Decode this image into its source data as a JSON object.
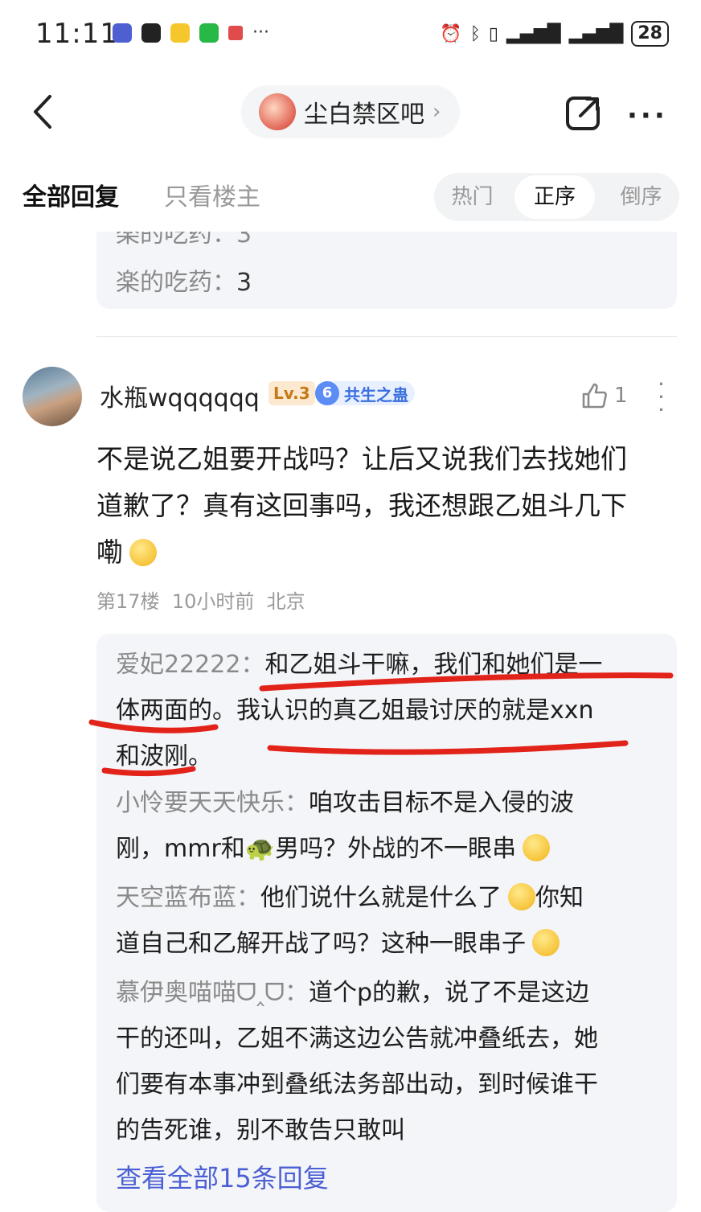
{
  "status_bar": {
    "time": "11:11",
    "battery": "28"
  },
  "header": {
    "forum_name": "尘白禁区吧",
    "more_label": "···"
  },
  "tabs": {
    "all_replies": "全部回复",
    "op_only": "只看楼主",
    "sort": [
      "热门",
      "正序",
      "倒序"
    ],
    "active_sort": "正序"
  },
  "previous_reply": {
    "cut_text": "楽的吃药：3",
    "user": "楽的吃药：",
    "value": "3"
  },
  "post": {
    "username": "水瓶wqqqqqq",
    "level": "Lv.3",
    "title_num": "6",
    "title": "共生之蛊",
    "likes": "1",
    "body_line1": "不是说乙姐要开战吗？让后又说我们去找她们",
    "body_line2": "道歉了？真有这回事吗，我还想跟乙姐斗几下",
    "body_line3": "嘞",
    "floor": "第17楼",
    "time": "10小时前",
    "location": "北京"
  },
  "replies": [
    {
      "user": "爱妃22222：",
      "lines": [
        "和乙姐斗干嘛，我们和她们是一",
        "体两面的。我认识的真乙姐最讨厌的就是xxn",
        "和波刚。"
      ]
    },
    {
      "user": "小怜要天天快乐：",
      "lines": [
        "咱攻击目标不是入侵的波",
        "刚，mmr和🐢男吗？外战的不一眼串"
      ]
    },
    {
      "user": "天空蓝布蓝：",
      "lines": [
        "他们说什么就是什么了",
        "你知",
        "道自己和乙解开战了吗？这种一眼串子"
      ]
    },
    {
      "user": "慕伊奥喵喵ᗜ‸ᗜ：",
      "lines": [
        "道个p的歉，说了不是这边",
        "干的还叫，乙姐不满这边公告就冲叠纸去，她",
        "们要有本事冲到叠纸法务部出动，到时候谁干",
        "的告死谁，别不敢告只敢叫"
      ]
    }
  ],
  "view_all": "查看全部15条回复"
}
